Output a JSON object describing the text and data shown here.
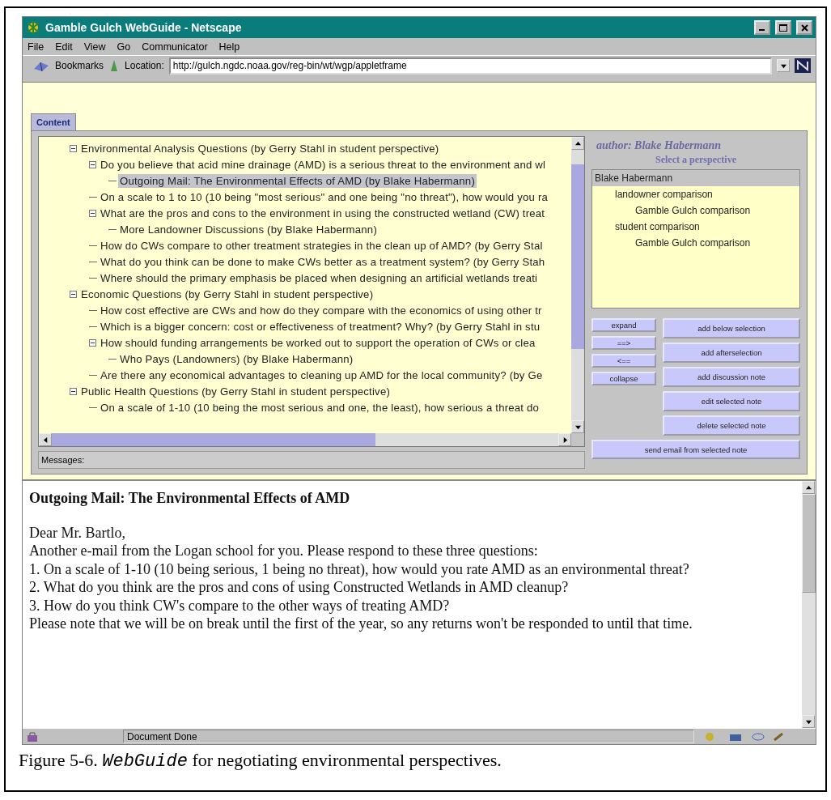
{
  "window": {
    "title": "Gamble Gulch WebGuide - Netscape"
  },
  "menu": [
    "File",
    "Edit",
    "View",
    "Go",
    "Communicator",
    "Help"
  ],
  "toolbar": {
    "bookmarks": "Bookmarks",
    "location_label": "Location:",
    "url": "http://gulch.ngdc.noaa.gov/reg-bin/wt/wgp/appletframe"
  },
  "tabs": [
    {
      "label": "Content",
      "selected": true
    }
  ],
  "tree": [
    {
      "label": "Environmental Analysis Questions  (by Gerry Stahl in student perspective)",
      "selected": false,
      "expanded": true,
      "children": [
        {
          "label": "Do you believe that acid mine drainage (AMD) is a serious threat to the environment and wl",
          "selected": false,
          "expanded": true,
          "children": [
            {
              "label": "Outgoing Mail: The Environmental Effects of AMD  (by Blake Habermann)",
              "selected": true
            }
          ]
        },
        {
          "label": "On a scale to 1 to 10 (10 being \"most serious\" and one being \"no threat\"), how would you ra",
          "selected": false
        },
        {
          "label": "What are the pros and cons to the environment in using the constructed wetland (CW) treat",
          "selected": false,
          "expanded": true,
          "children": [
            {
              "label": "More Landowner Discussions  (by Blake Habermann)",
              "selected": false
            }
          ]
        },
        {
          "label": "How do CWs compare to other treatment strategies in the clean up of  AMD?  (by Gerry Stal",
          "selected": false
        },
        {
          "label": "What do you think can be done to make CWs better as a treatment system?  (by Gerry Stah",
          "selected": false
        },
        {
          "label": "Where should the primary emphasis be placed when designing an artificial wetlands treati",
          "selected": false
        }
      ]
    },
    {
      "label": "Economic Questions  (by Gerry Stahl in student perspective)",
      "selected": false,
      "expanded": true,
      "children": [
        {
          "label": "How cost effective are CWs and how do they compare with the economics of using other tr",
          "selected": false
        },
        {
          "label": "Which is a bigger concern:  cost or effectiveness of treatment?  Why?  (by Gerry Stahl in stu",
          "selected": false
        },
        {
          "label": "How should funding arrangements be worked out to support the operation of  CWs or clea",
          "selected": false,
          "expanded": true,
          "children": [
            {
              "label": "Who Pays (Landowners)  (by Blake Habermann)",
              "selected": false
            }
          ]
        },
        {
          "label": "Are there any economical advantages to cleaning up AMD for the local community?  (by Ge",
          "selected": false
        }
      ]
    },
    {
      "label": "Public Health Questions  (by Gerry Stahl in student perspective)",
      "selected": false,
      "expanded": true,
      "children": [
        {
          "label": "On a scale of 1-10 (10 being the most serious and one, the least), how serious a threat do",
          "selected": false
        }
      ]
    }
  ],
  "messages_label": "Messages:",
  "author": "author: Blake Habermann",
  "perspective_heading": "Select a perspective",
  "perspectives": [
    {
      "label": "Blake Habermann",
      "selected": true,
      "children": [
        {
          "label": "landowner comparison",
          "selected": false,
          "children": [
            {
              "label": "Gamble Gulch comparison",
              "selected": false
            }
          ]
        },
        {
          "label": "student comparison",
          "selected": false,
          "children": [
            {
              "label": "Gamble Gulch comparison",
              "selected": false
            }
          ]
        }
      ]
    }
  ],
  "nav_buttons": [
    "expand",
    "==>",
    "<==",
    "collapse"
  ],
  "note_buttons": [
    "add below selection",
    "add afterselection",
    "add discussion note",
    "edit selected note",
    "delete selected note"
  ],
  "send_button": "send email from selected note",
  "note": {
    "title": "Outgoing Mail: The Environmental Effects of AMD",
    "lines": [
      "Dear Mr. Bartlo,",
      "Another e-mail from the Logan school for you. Please respond to these three questions:",
      "1. On a scale of 1-10 (10 being serious, 1 being no threat), how would you rate AMD as an environmental threat?",
      "2. What do you think are the pros and cons of using Constructed Wetlands in AMD cleanup?",
      "3. How do you think CW's compare to the other ways of treating AMD?",
      "Please note that we will be on break until the first of the year, so any returns won't be responded to until that time."
    ]
  },
  "status_bar": {
    "text": "Document Done"
  },
  "caption": {
    "prefix": "Figure 5-6.",
    "name": "WebGuide",
    "rest": "for negotiating environmental perspectives."
  }
}
